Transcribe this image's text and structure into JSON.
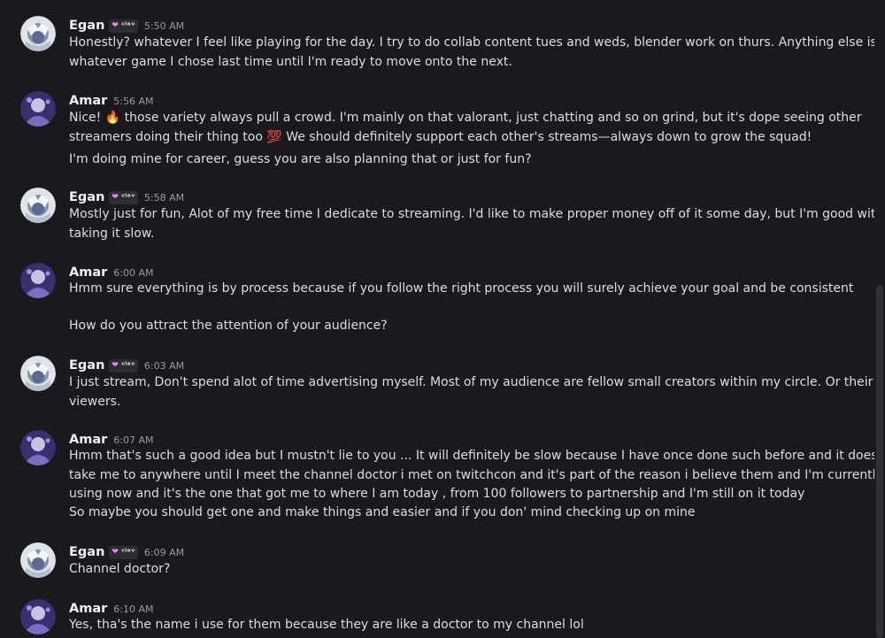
{
  "messages": [
    {
      "author": "Egan",
      "tag": "ᶜˡᵃᵛ",
      "time": "5:50 AM",
      "lines": [
        "Honestly? whatever I feel like playing for the day. I try to do collab content tues and weds, blender work on thurs. Anything else is",
        "whatever game I chose last time until I'm ready to move onto the next."
      ]
    },
    {
      "author": "Amar",
      "time": "5:56 AM",
      "lines": [
        "Nice! 🔥 those variety always pull a crowd. I'm mainly on that valorant, just chatting and so on grind, but it's dope seeing other",
        "streamers doing their thing too 💯 We should definitely support each other's streams—always down to grow the squad!",
        "I'm doing mine for career, guess you are also planning that or just for fun?"
      ]
    },
    {
      "author": "Egan",
      "tag": "ᶜˡᵃᵛ",
      "time": "5:58 AM",
      "lines": [
        "Mostly just for fun, Alot of my free time I dedicate to streaming. I'd like to make proper money off of it some day, but I'm good with",
        "taking it slow."
      ]
    },
    {
      "author": "Amar",
      "time": "6:00 AM",
      "lines": [
        "Hmm sure everything is by process because if you follow the right process you will surely achieve your goal and be consistent",
        "How do you attract the attention of your audience?"
      ]
    },
    {
      "author": "Egan",
      "tag": "ᶜˡᵃᵛ",
      "time": "6:03 AM",
      "lines": [
        "I just stream, Don't spend alot of time advertising myself. Most of my audience are fellow small creators within my circle. Or their",
        "viewers."
      ]
    },
    {
      "author": "Amar",
      "time": "6:07 AM",
      "lines": [
        "Hmm that's such a good idea but I mustn't lie to you ... It will definitely be  slow because I have once done such before and it doesn't",
        "take me to anywhere until I meet the channel doctor i met on twitchcon and it's part of the reason i believe them and  I'm currently",
        "using now and it's the one that got me to where I am today , from 100 followers to partnership and I'm still on it today",
        "So maybe you should get one and make things  and easier and if you don' mind checking up on mine"
      ]
    },
    {
      "author": "Egan",
      "tag": "ᶜˡᵃᵛ",
      "time": "6:09 AM",
      "lines": [
        "Channel doctor?"
      ]
    },
    {
      "author": "Amar",
      "time": "6:10 AM",
      "lines": [
        "Yes, tha's the name i use for them because they are like a doctor to my channel lol"
      ]
    }
  ],
  "colors": {
    "background": "#1a1a1e",
    "username": "#f2f3f5",
    "text": "#dbdee1",
    "timestamp": "#949ba4",
    "tag_heart": "#f47fff"
  }
}
